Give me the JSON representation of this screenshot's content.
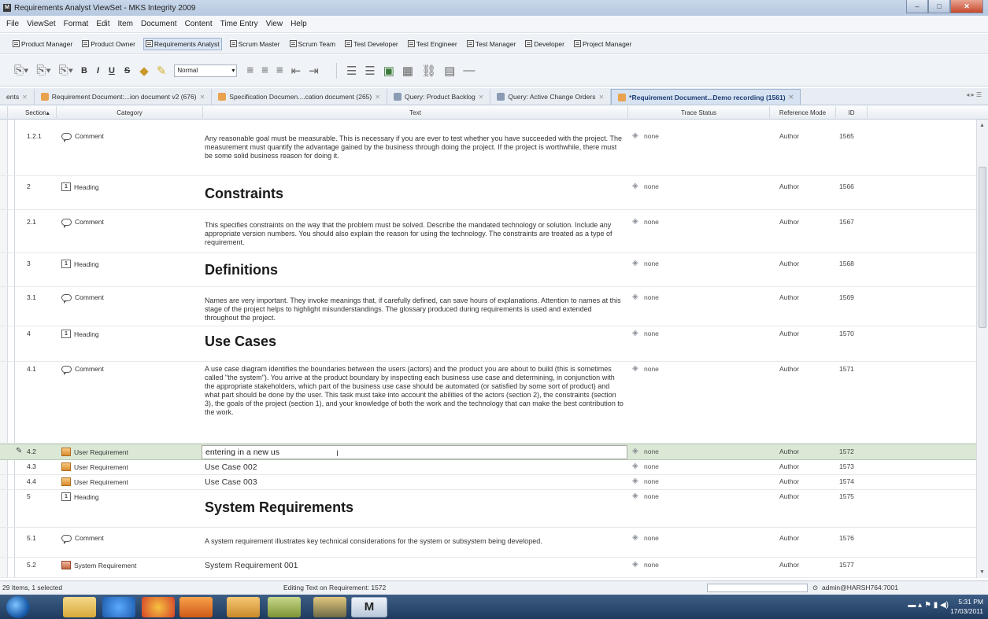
{
  "window": {
    "title": "Requirements Analyst ViewSet - MKS Integrity 2009",
    "app_icon": "M"
  },
  "menu": [
    "File",
    "ViewSet",
    "Format",
    "Edit",
    "Item",
    "Document",
    "Content",
    "Time Entry",
    "View",
    "Help"
  ],
  "views": [
    "Product Manager",
    "Product Owner",
    "Requirements Analyst",
    "Scrum Master",
    "Scrum Team",
    "Test Developer",
    "Test Engineer",
    "Test Manager",
    "Developer",
    "Project Manager"
  ],
  "toolbar": {
    "bold": "B",
    "italic": "I",
    "underline": "U",
    "strike": "S",
    "style_value": "Normal"
  },
  "tabs": [
    "ents",
    "Requirement Document:...ion document v2 (676)",
    "Specification Documen....cation document (265)",
    "Query: Product Backlog",
    "Query: Active Change Orders",
    "*Requirement Document...Demo recording (1561)"
  ],
  "columns": {
    "section": "Section",
    "category": "Category",
    "text": "Text",
    "trace": "Trace Status",
    "ref": "Reference Mode",
    "id": "ID"
  },
  "rows": [
    {
      "section": "1.2.1",
      "category": "Comment",
      "text": "Any reasonable goal must be measurable. This is necessary if you are ever to test whether you have succeeded with the project. The measurement must quantify the advantage gained by the business through doing the project. If the project is worthwhile, there must be some solid business reason for doing it.",
      "trace": "none",
      "ref": "Author",
      "id": "1565"
    },
    {
      "section": "2",
      "category": "Heading",
      "text": "Constraints",
      "trace": "none",
      "ref": "Author",
      "id": "1566"
    },
    {
      "section": "2.1",
      "category": "Comment",
      "text": "This specifies constraints on the way that the problem must be solved. Describe the mandated technology or solution. Include any appropriate version numbers. You should also explain the reason for using the technology. The constraints are treated as a type of requirement.",
      "trace": "none",
      "ref": "Author",
      "id": "1567"
    },
    {
      "section": "3",
      "category": "Heading",
      "text": "Definitions",
      "trace": "none",
      "ref": "Author",
      "id": "1568"
    },
    {
      "section": "3.1",
      "category": "Comment",
      "text": "Names are very important. They invoke meanings that, if carefully defined, can save hours of explanations. Attention to names at this stage of the project helps to highlight misunderstandings. The glossary produced during requirements is used and extended throughout the project.",
      "trace": "none",
      "ref": "Author",
      "id": "1569"
    },
    {
      "section": "4",
      "category": "Heading",
      "text": "Use Cases",
      "trace": "none",
      "ref": "Author",
      "id": "1570"
    },
    {
      "section": "4.1",
      "category": "Comment",
      "text": "A use case diagram identifies the boundaries between the users (actors) and the product you are about to build (this is sometimes called \"the system\"). You arrive at the product boundary by inspecting each business use case and determining, in conjunction with the appropriate stakeholders, which part of the business use case should be automated (or satisfied by some sort of product) and what part should be done by the user. This task must take into account the abilities of the actors (section 2), the constraints (section 3), the goals of the project (section 1), and your knowledge of both the work and the technology that can make the best contribution to the work.",
      "trace": "none",
      "ref": "Author",
      "id": "1571"
    },
    {
      "section": "4.2",
      "category": "User Requirement",
      "text": "entering in a new us",
      "trace": "none",
      "ref": "Author",
      "id": "1572"
    },
    {
      "section": "4.3",
      "category": "User Requirement",
      "text": "Use Case 002",
      "trace": "none",
      "ref": "Author",
      "id": "1573"
    },
    {
      "section": "4.4",
      "category": "User Requirement",
      "text": "Use Case 003",
      "trace": "none",
      "ref": "Author",
      "id": "1574"
    },
    {
      "section": "5",
      "category": "Heading",
      "text": "System Requirements",
      "trace": "none",
      "ref": "Author",
      "id": "1575"
    },
    {
      "section": "5.1",
      "category": "Comment",
      "text": "A system requirement illustrates key technical considerations for the system or subsystem being developed.",
      "trace": "none",
      "ref": "Author",
      "id": "1576"
    },
    {
      "section": "5.2",
      "category": "System Requirement",
      "text": "System Requirement 001",
      "trace": "none",
      "ref": "Author",
      "id": "1577"
    }
  ],
  "status": {
    "items": "29 Items, 1 selected",
    "editing": "Editing Text on Requirement: 1572",
    "server": "admin@HARSH764:7001"
  },
  "clock": {
    "time": "5:31 PM",
    "date": "17/03/2011"
  },
  "taskbar_active_label": "M"
}
